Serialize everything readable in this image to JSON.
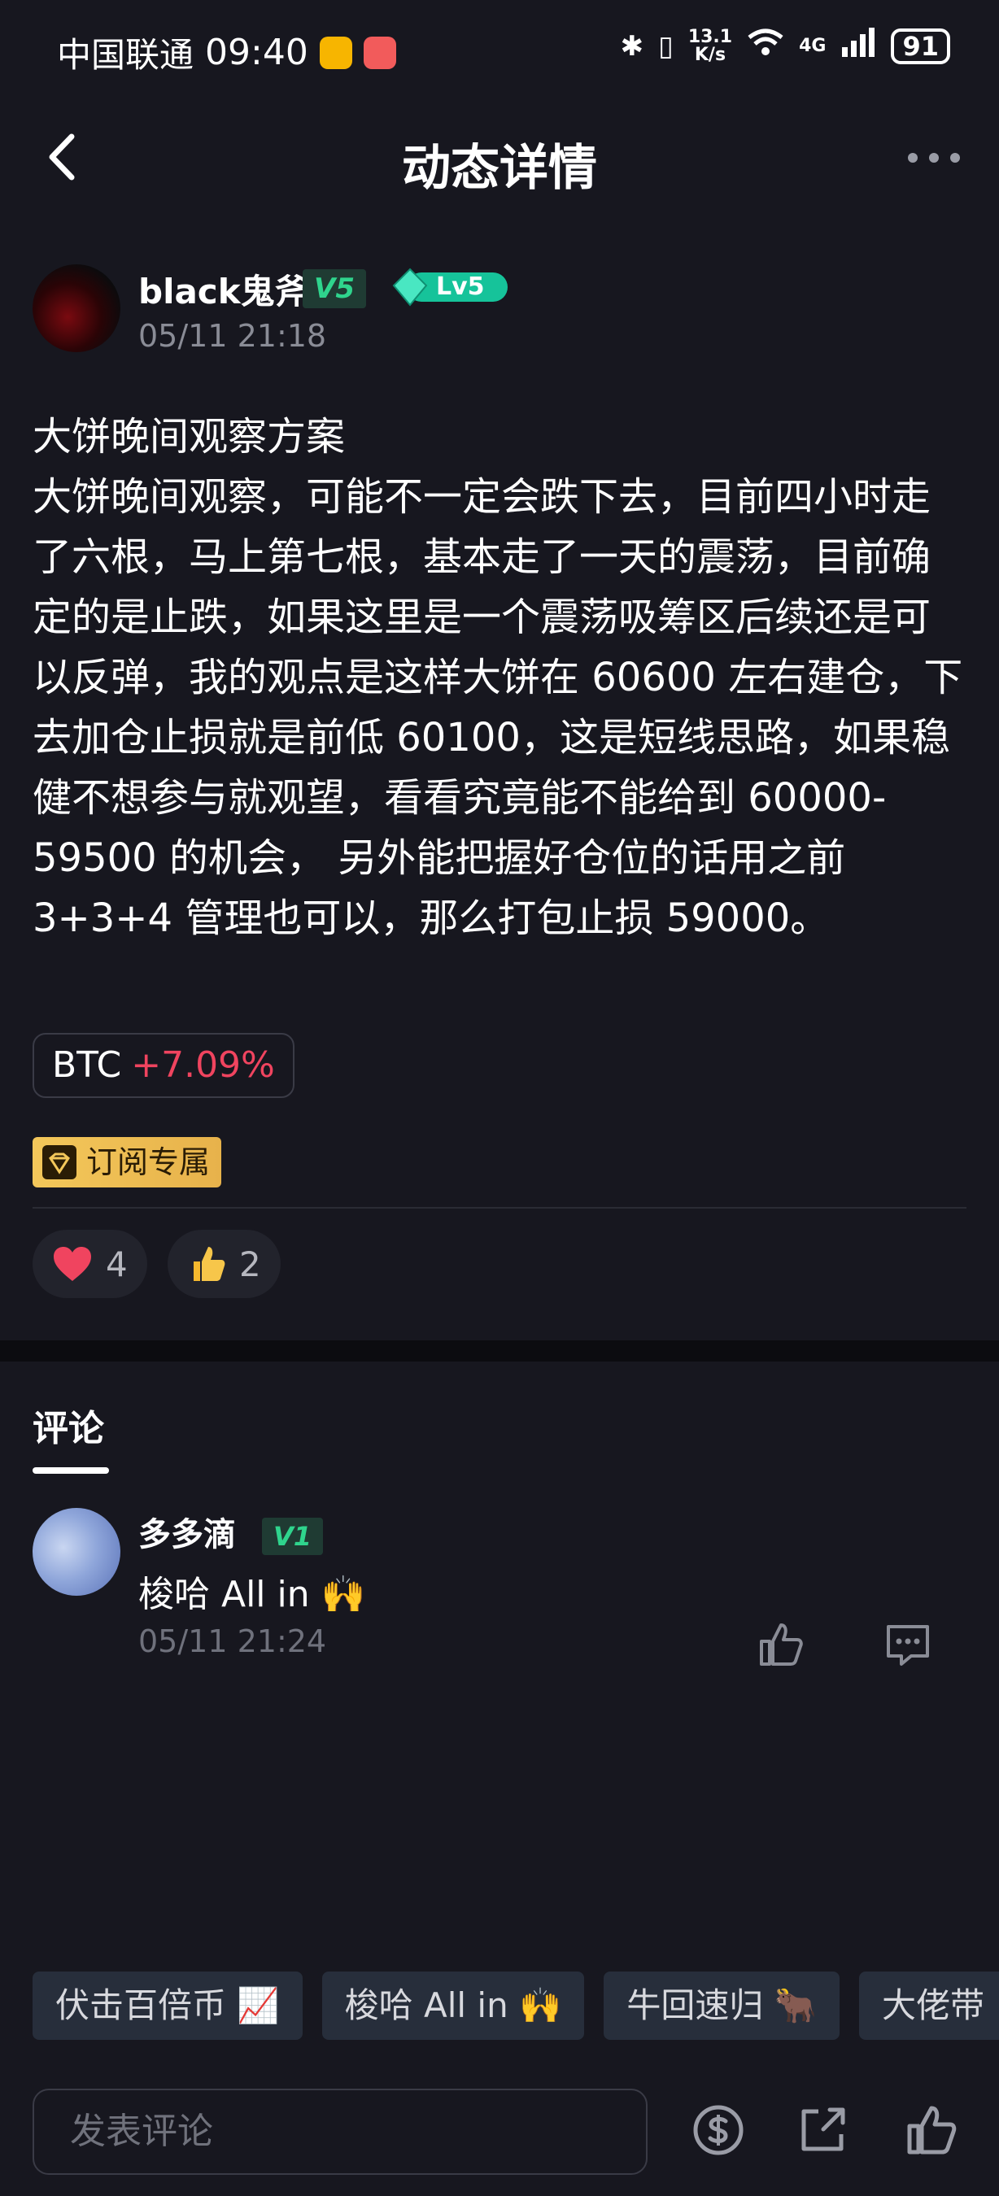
{
  "status_bar": {
    "carrier": "中国联通",
    "time": "09:40",
    "net_speed_top": "13.1",
    "net_speed_bottom": "K/s",
    "network": "4G",
    "battery": "91"
  },
  "nav": {
    "title": "动态详情"
  },
  "author": {
    "name": "black鬼斧",
    "v_badge": "V5",
    "level_badge": "Lv5",
    "time": "05/11 21:18"
  },
  "post": {
    "title": "大饼晚间观察方案",
    "body": "大饼晚间观察，可能不一定会跌下去，目前四小时走了六根，马上第七根，基本走了一天的震荡，目前确定的是止跌，如果这里是一个震荡吸筹区后续还是可以反弹，我的观点是这样大饼在 60600 左右建仓，下去加仓止损就是前低 60100，这是短线思路，如果稳健不想参与就观望，看看究竟能不能给到 60000-59500 的机会， 另外能把握好仓位的话用之前 3+3+4 管理也可以，那么打包止损 59000。",
    "coin_tag": {
      "symbol": "BTC",
      "change": "+7.09%",
      "change_color": "#f0445f"
    },
    "subscribe_badge": "订阅专属",
    "reactions": [
      {
        "icon": "heart-icon",
        "count": "4"
      },
      {
        "icon": "thumbs-up-emoji-icon",
        "count": "2"
      }
    ]
  },
  "comments": {
    "tab_label": "评论",
    "items": [
      {
        "name": "多多滴",
        "v_badge": "V1",
        "text": "梭哈 All in 🙌",
        "time": "05/11 21:24"
      }
    ]
  },
  "quick_replies": [
    "伏击百倍币 📈",
    "梭哈 All in 🙌",
    "牛回速归 🐂",
    "大佬带"
  ],
  "bottom_bar": {
    "input_placeholder": "发表评论"
  },
  "colors": {
    "background": "#17171f",
    "accent_green": "#2fd48d",
    "positive_red": "#f0445f",
    "gold": "#f3c75a"
  }
}
